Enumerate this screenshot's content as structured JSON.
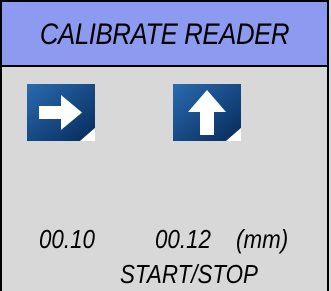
{
  "header": {
    "title": "CALIBRATE READER"
  },
  "buttons": {
    "next": {
      "icon": "arrow-right-icon"
    },
    "up": {
      "icon": "arrow-up-icon"
    }
  },
  "readings": {
    "left_value": "00.10",
    "right_value": "00.12",
    "unit": "(mm)"
  },
  "actions": {
    "start_stop_label": "START/STOP"
  },
  "colors": {
    "header_bg": "#8c9af0",
    "panel_bg": "#d8d8d8",
    "icon_blue": "#0d3f7a"
  }
}
